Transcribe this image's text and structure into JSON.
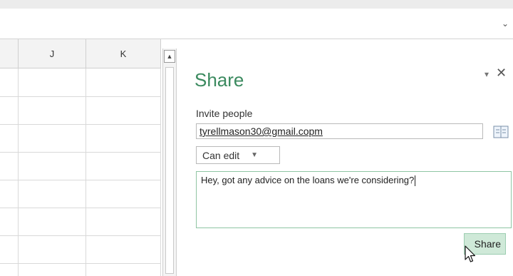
{
  "formula_bar": {
    "expand_icon": "chevron-down-icon",
    "expand_glyph": "⌄"
  },
  "sheet": {
    "columns": [
      "",
      "J",
      "K"
    ]
  },
  "scrollbar": {
    "up_glyph": "▲"
  },
  "share_pane": {
    "title": "Share",
    "dropdown_glyph": "▾",
    "close_glyph": "✕",
    "invite_label": "Invite people",
    "email_value": "tyrellmason30@gmail.copm",
    "address_book_icon": "address-book-icon",
    "permission": "Can edit",
    "permission_arrow": "▼",
    "message": "Hey, got any advice on the loans we're considering?",
    "share_button": "Share"
  },
  "colors": {
    "accent_green": "#3b8a5f",
    "button_bg": "#cfe9d8",
    "message_border": "#8fc5a3"
  }
}
